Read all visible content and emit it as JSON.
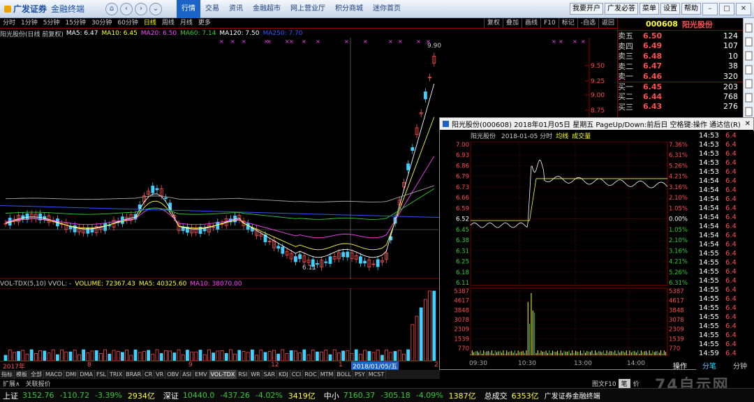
{
  "titlebar": {
    "brand": "广发证券",
    "product": "金融终端",
    "menu": [
      "行情",
      "交易",
      "资讯",
      "金融超市",
      "网上营业厅",
      "积分商城",
      "迷你首页"
    ],
    "right_buttons": [
      "我要开户",
      "广发必答",
      "菜单",
      "设置",
      "帮助"
    ]
  },
  "periods": [
    "分时",
    "1分钟",
    "5分钟",
    "15分钟",
    "30分钟",
    "60分钟",
    "日线",
    "周线",
    "月线",
    "更多"
  ],
  "active_period": "日线",
  "tools": [
    "复权",
    "叠加",
    "画线",
    "F10",
    "标记",
    "-自选",
    "返回"
  ],
  "ma_legend": {
    "stock": "阳光股份(日线 前复权)",
    "ma5": "MA5: 6.47",
    "ma10": "MA10: 6.45",
    "ma20": "MA20: 6.50",
    "ma60": "MA60: 7.14",
    "ma120": "MA120: 7.50",
    "ma250": "MA250: 7.70"
  },
  "kline": {
    "price_labels": [
      "9.50",
      "9.25",
      "9.00",
      "8.75"
    ],
    "high_label": "9.90",
    "low_label": "6.11"
  },
  "volume": {
    "head": "VOL-TDX(5,10)  VVOL: -",
    "volume": "VOLUME: 72367.43",
    "ma5": "MA5: 40325.60",
    "ma10": "MA10: 38070.00"
  },
  "dates": {
    "year": "2017年",
    "m8": "8",
    "m9": "9",
    "m12": "12",
    "m1": "1",
    "cursor": "2018/01/05/五",
    "m2": "2"
  },
  "indicators": [
    "指标",
    "模板",
    "全部",
    "MACD",
    "DMI",
    "DMA",
    "FSL",
    "TRIX",
    "BRAR",
    "CR",
    "VR",
    "OBV",
    "ASI",
    "EMV",
    "VOL-TDX",
    "RSI",
    "WR",
    "SAR",
    "KDJ",
    "CCI",
    "ROC",
    "MTM",
    "BOLL",
    "PSY",
    "MCST"
  ],
  "active_indicator": "VOL-TDX",
  "expand_bar": [
    "扩展∧",
    "关联报价"
  ],
  "quote": {
    "code": "000608",
    "name": "阳光股份",
    "levels": [
      {
        "label": "卖五",
        "price": "6.50",
        "vol": "124"
      },
      {
        "label": "卖四",
        "price": "6.49",
        "vol": "107"
      },
      {
        "label": "卖三",
        "price": "6.48",
        "vol": "10"
      },
      {
        "label": "卖二",
        "price": "6.47",
        "vol": "38"
      },
      {
        "label": "卖一",
        "price": "6.46",
        "vol": "320"
      },
      {
        "label": "买一",
        "price": "6.45",
        "vol": "203"
      },
      {
        "label": "买二",
        "price": "6.44",
        "vol": "768"
      },
      {
        "label": "买三",
        "price": "6.43",
        "vol": "276"
      }
    ]
  },
  "popup": {
    "title": "阳光股份(000608) 2018年01月05日 星期五 PageUp/Down:前后日 空格键:操作 通达信(R)",
    "stock": "阳光股份",
    "date": "2018-01-05 分时",
    "avg": "均线",
    "vol": "成交量",
    "left_axis": [
      "7.00",
      "6.93",
      "6.86",
      "6.79",
      "6.73",
      "6.66",
      "6.59",
      "6.52",
      "6.45",
      "6.38",
      "6.31",
      "6.25",
      "6.18",
      "6.11"
    ],
    "right_axis": [
      "7.36%",
      "6.31%",
      "5.26%",
      "4.21%",
      "3.16%",
      "2.10%",
      "1.05%",
      "0.00%",
      "1.05%",
      "2.10%",
      "3.16%",
      "4.21%",
      "5.26%",
      "6.31%"
    ],
    "vol_axis": [
      "5387",
      "4617",
      "3848",
      "3078",
      "2309",
      "1539",
      "770"
    ],
    "time_axis": [
      "09:30",
      "10:30",
      "13:00",
      "14:00"
    ]
  },
  "trades": [
    "14:53",
    "14:53",
    "14:53",
    "14:53",
    "14:53",
    "14:54",
    "14:54",
    "14:54",
    "14:54",
    "14:54",
    "14:54",
    "14:54",
    "14:54",
    "14:55",
    "14:55",
    "14:55",
    "14:55",
    "14:55",
    "14:55",
    "14:55",
    "14:55",
    "14:55",
    "14:55",
    "14:55",
    "14:59"
  ],
  "trade_price": "6.4",
  "bottom_tabs": {
    "op": "操作",
    "tick": "分笔",
    "tick2": "分钟"
  },
  "bottom_tabs2": [
    "图文F10",
    "笔",
    "价"
  ],
  "status": {
    "sh_label": "上证",
    "sh": "3152.76",
    "sh_chg": "-110.72",
    "sh_pct": "-3.39%",
    "sh_amt": "2934亿",
    "sz_label": "深证",
    "sz": "10440.0",
    "sz_chg": "-437.26",
    "sz_pct": "-4.02%",
    "sz_amt": "3419亿",
    "zx_label": "中小",
    "zx": "7160.37",
    "zx_chg": "-305.18",
    "zx_pct": "-4.09%",
    "zx_amt": "1387亿",
    "total_label": "总成交",
    "total": "6353亿",
    "broker": "广发证券金融终端"
  },
  "watermark": "74自示网",
  "colors": {
    "up": "#ff4d4d",
    "down": "#33cc33",
    "ma5": "#ffffff",
    "ma10": "#ffff33",
    "ma20": "#ff44ff",
    "ma60": "#33cc33",
    "ma120": "#ffffff",
    "ma250": "#3355ff",
    "volume": "#3fd0ff"
  }
}
